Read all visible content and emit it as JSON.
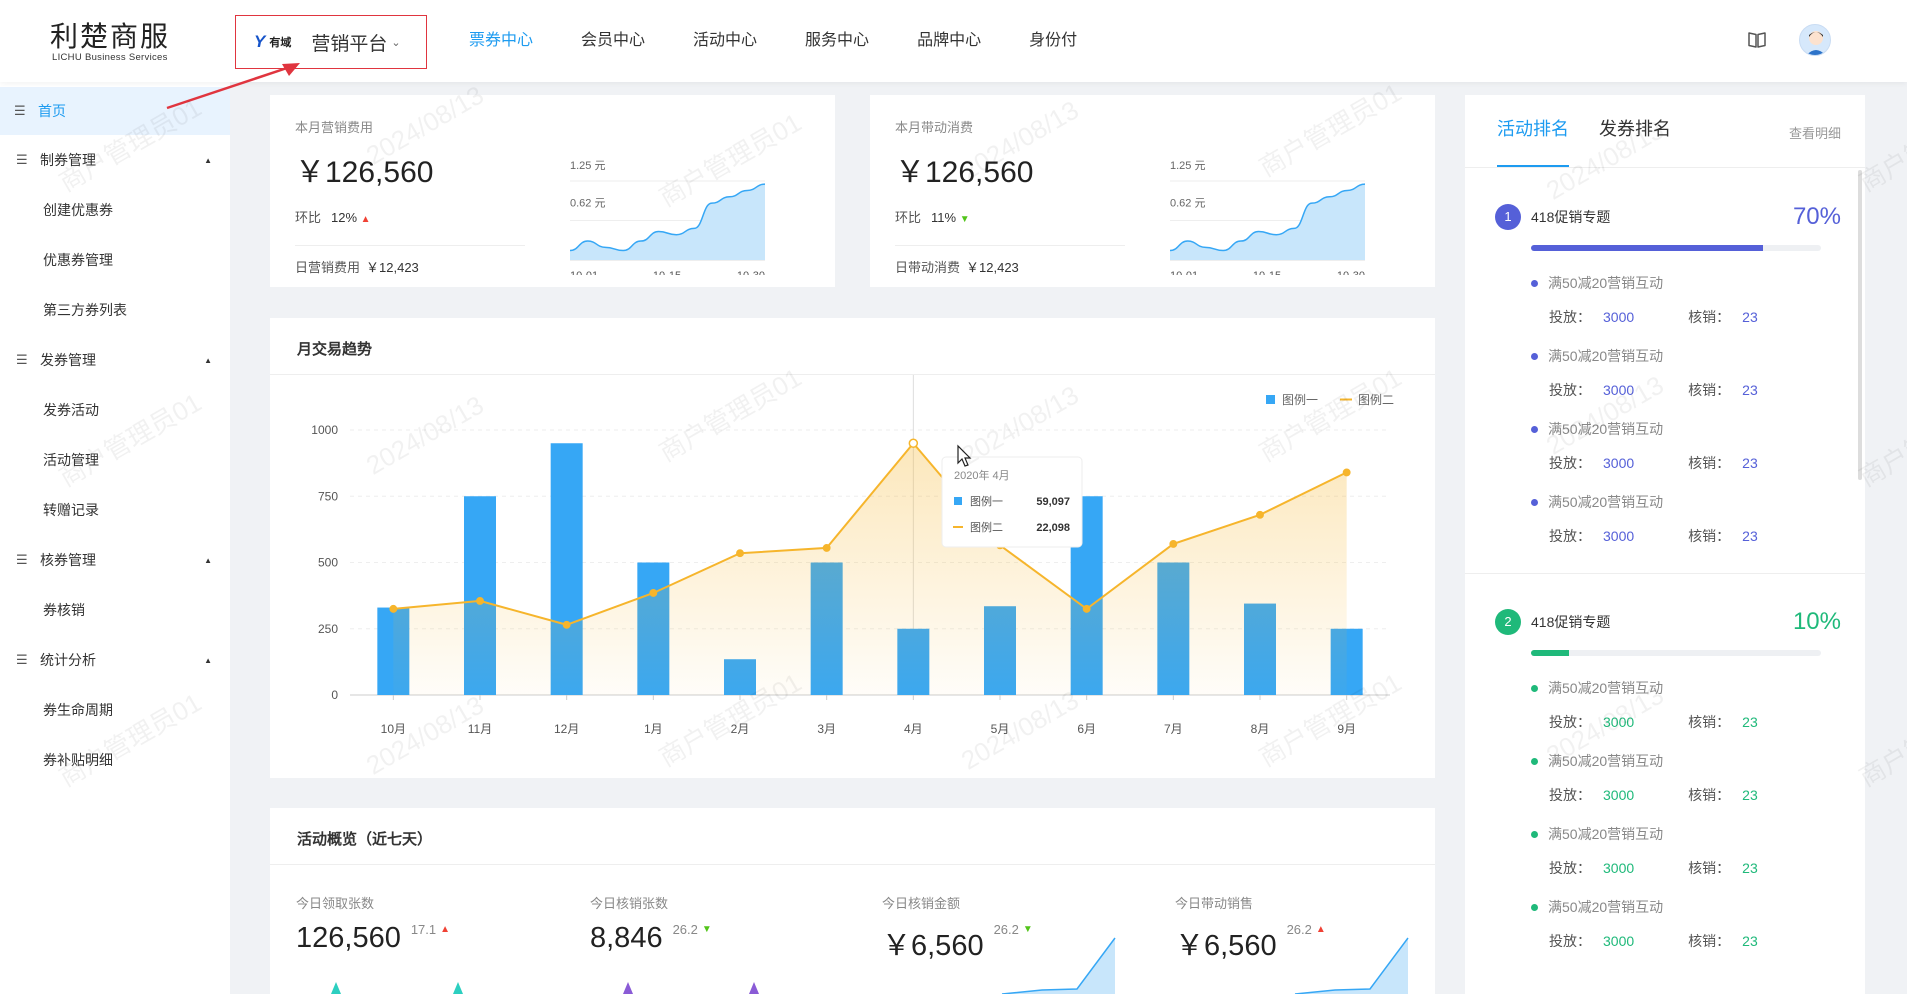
{
  "header": {
    "logo_cn": "利楚商服",
    "logo_en": "LICHU Business Services",
    "platform_brand": "有域",
    "platform_name": "营销平台",
    "nav": [
      "票券中心",
      "会员中心",
      "活动中心",
      "服务中心",
      "品牌中心",
      "身份付"
    ],
    "active_nav": 0
  },
  "sidebar": {
    "home": "首页",
    "groups": [
      {
        "label": "制券管理",
        "items": [
          "创建优惠券",
          "优惠券管理",
          "第三方券列表"
        ]
      },
      {
        "label": "发券管理",
        "items": [
          "发券活动",
          "活动管理",
          "转赠记录"
        ]
      },
      {
        "label": "核券管理",
        "items": [
          "券核销"
        ]
      },
      {
        "label": "统计分析",
        "items": [
          "券生命周期",
          "券补贴明细"
        ]
      }
    ]
  },
  "stats": [
    {
      "label": "本月营销费用",
      "value": "￥126,560",
      "cmp_label": "环比",
      "cmp_value": "12%",
      "trend": "up",
      "daily_label": "日营销费用",
      "daily_value": "￥12,423"
    },
    {
      "label": "本月带动消费",
      "value": "￥126,560",
      "cmp_label": "环比",
      "cmp_value": "11%",
      "trend": "down",
      "daily_label": "日带动消费",
      "daily_value": "￥12,423"
    }
  ],
  "sparkline": {
    "y_ticks": [
      "1.25 元",
      "0.62 元"
    ],
    "x_ticks": [
      "10-01",
      "10-15",
      "10-30"
    ],
    "values": [
      0.15,
      0.3,
      0.2,
      0.15,
      0.3,
      0.45,
      0.4,
      0.5,
      0.9,
      1.0,
      1.1,
      1.2
    ]
  },
  "trend": {
    "title": "月交易趋势",
    "legend": [
      "图例一",
      "图例二"
    ],
    "tooltip": {
      "title": "2020年 4月",
      "rows": [
        {
          "name": "图例一",
          "value": "59,097"
        },
        {
          "name": "图例二",
          "value": "22,098"
        }
      ]
    }
  },
  "chart_data": {
    "type": "bar",
    "categories": [
      "10月",
      "11月",
      "12月",
      "1月",
      "2月",
      "3月",
      "4月",
      "5月",
      "6月",
      "7月",
      "8月",
      "9月"
    ],
    "series": [
      {
        "name": "图例一",
        "type": "bar",
        "values": [
          330,
          750,
          950,
          500,
          135,
          500,
          250,
          335,
          750,
          500,
          345,
          250
        ]
      },
      {
        "name": "图例二",
        "type": "line",
        "values": [
          325,
          355,
          265,
          385,
          535,
          555,
          950,
          565,
          325,
          570,
          680,
          840
        ]
      }
    ],
    "y_ticks": [
      0,
      250,
      500,
      750,
      1000
    ],
    "ylim": [
      0,
      1000
    ],
    "colors": [
      "#36a7f5",
      "#f6b52c"
    ]
  },
  "overview": {
    "title": "活动概览（近七天）",
    "items": [
      {
        "label": "今日领取张数",
        "value": "126,560",
        "delta": "17.1",
        "trend": "up"
      },
      {
        "label": "今日核销张数",
        "value": "8,846",
        "delta": "26.2",
        "trend": "down"
      },
      {
        "label": "今日核销金额",
        "value": "￥6,560",
        "delta": "26.2",
        "trend": "down"
      },
      {
        "label": "今日带动销售",
        "value": "￥6,560",
        "delta": "26.2",
        "trend": "up"
      }
    ]
  },
  "ranking": {
    "tabs": [
      "活动排名",
      "发券排名"
    ],
    "more": "查看明细",
    "sections": [
      {
        "rank": "1",
        "name": "418促销专题",
        "pct": "70%",
        "progress": 0.8,
        "color": "#5560d8",
        "rows": [
          {
            "title": "满50减20营销互动",
            "put_label": "投放：",
            "put": "3000",
            "use_label": "核销：",
            "use": "23"
          },
          {
            "title": "满50减20营销互动",
            "put_label": "投放：",
            "put": "3000",
            "use_label": "核销：",
            "use": "23"
          },
          {
            "title": "满50减20营销互动",
            "put_label": "投放：",
            "put": "3000",
            "use_label": "核销：",
            "use": "23"
          },
          {
            "title": "满50减20营销互动",
            "put_label": "投放：",
            "put": "3000",
            "use_label": "核销：",
            "use": "23"
          }
        ]
      },
      {
        "rank": "2",
        "name": "418促销专题",
        "pct": "10%",
        "progress": 0.13,
        "color": "#1fb97a",
        "rows": [
          {
            "title": "满50减20营销互动",
            "put_label": "投放：",
            "put": "3000",
            "use_label": "核销：",
            "use": "23"
          },
          {
            "title": "满50减20营销互动",
            "put_label": "投放：",
            "put": "3000",
            "use_label": "核销：",
            "use": "23"
          },
          {
            "title": "满50减20营销互动",
            "put_label": "投放：",
            "put": "3000",
            "use_label": "核销：",
            "use": "23"
          },
          {
            "title": "满50减20营销互动",
            "put_label": "投放：",
            "put": "3000",
            "use_label": "核销：",
            "use": "23"
          }
        ]
      }
    ]
  },
  "watermark": {
    "user": "商户管理员01",
    "date": "2024/08/13"
  }
}
